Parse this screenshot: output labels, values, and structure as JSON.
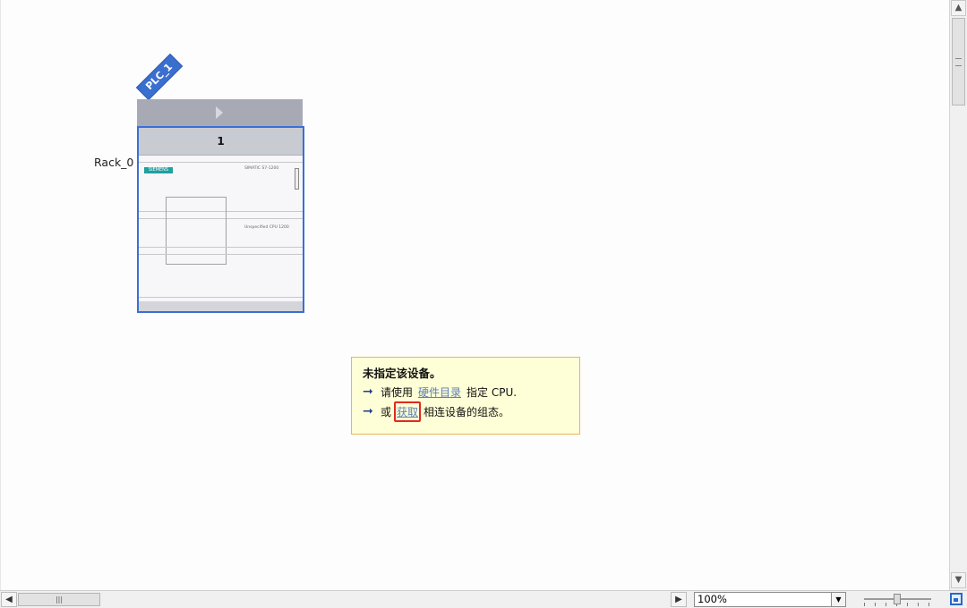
{
  "device": {
    "plc_name": "PLC_1",
    "rack_label": "Rack_0",
    "slot_number": "1",
    "brand": "SIEMENS",
    "cpu_model_text": "SIMATIC S7-1200",
    "cpu_sub_text": "Unspecified CPU 1200"
  },
  "info_box": {
    "title": "未指定该设备。",
    "line1_prefix": "请使用",
    "line1_link": "硬件目录",
    "line1_suffix": "指定 CPU.",
    "line2_prefix": "或",
    "line2_link": "获取",
    "line2_suffix": "相连设备的组态。"
  },
  "bottom_bar": {
    "zoom_value": "100%"
  },
  "colors": {
    "accent": "#3a6fd6",
    "info_bg": "#fefed7",
    "info_border": "#e8b94b",
    "highlight": "#e02a1e",
    "link": "#5a7fb3"
  },
  "icons": {
    "scroll_up": "chevron-up-icon",
    "scroll_down": "chevron-down-icon",
    "scroll_left": "chevron-left-icon",
    "scroll_right": "chevron-right-icon",
    "arrow": "arrow-right-icon",
    "fit": "zoom-fit-icon"
  }
}
